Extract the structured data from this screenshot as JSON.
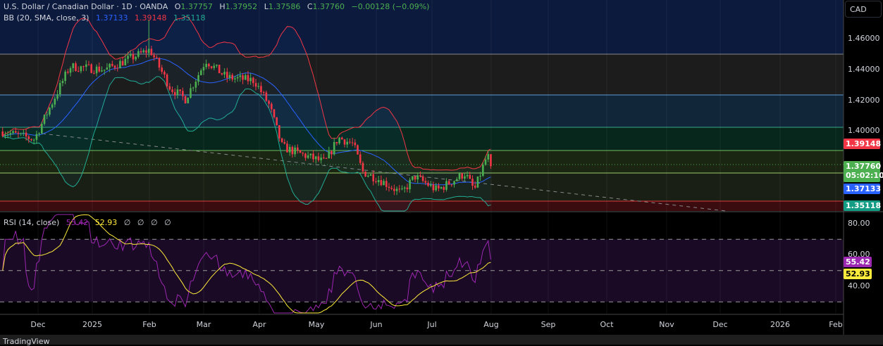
{
  "header": {
    "symbol": "U.S. Dollar / Canadian Dollar · 1D · OANDA",
    "o_label": "O",
    "o": "1.37757",
    "h_label": "H",
    "h": "1.37952",
    "l_label": "L",
    "l": "1.37586",
    "c_label": "C",
    "c": "1.37760",
    "change": "−0.00128 (−0.09%)"
  },
  "bb": {
    "label": "BB (20, SMA, close, 3)",
    "basis": "1.37133",
    "upper": "1.39148",
    "lower": "1.35118"
  },
  "rsi": {
    "label": "RSI (14, close)",
    "value": "55.42",
    "ma": "52.93",
    "extras": [
      "∅",
      "∅",
      "∅",
      "∅"
    ]
  },
  "currency_button": "CAD",
  "price_axis": [
    "1.46000",
    "1.44000",
    "1.42000",
    "1.40000"
  ],
  "price_tags": {
    "upper": "1.39148",
    "last": "1.37760",
    "countdown": "05:02:10",
    "basis": "1.37133",
    "lower": "1.35118"
  },
  "rsi_axis": [
    "80.00",
    "60.00",
    "40.00"
  ],
  "rsi_tags": {
    "rsi": "55.42",
    "ma": "52.93"
  },
  "time_axis": [
    "Dec",
    "2025",
    "Feb",
    "Mar",
    "Apr",
    "May",
    "Jun",
    "Jul",
    "Aug",
    "Sep",
    "Oct",
    "Nov",
    "Dec",
    "2026",
    "Feb"
  ],
  "footer": "TradingView",
  "colors": {
    "up": "#4caf50",
    "down": "#f23645",
    "upper": "#f23645",
    "basis": "#2962ff",
    "lower": "#22ab94",
    "rsi": "#9c27b0",
    "rsi_ma": "#ffeb3b"
  },
  "chart_data": {
    "type": "candlestick",
    "title": "USD/CAD 1D",
    "ylim": [
      1.345,
      1.485
    ],
    "key_closes": [
      [
        "2024-11-12",
        1.4
      ],
      [
        "2024-11-29",
        1.395
      ],
      [
        "2024-12-18",
        1.442
      ],
      [
        "2025-01-06",
        1.44
      ],
      [
        "2025-01-30",
        1.453
      ],
      [
        "2025-02-10",
        1.428
      ],
      [
        "2025-02-18",
        1.421
      ],
      [
        "2025-03-01",
        1.446
      ],
      [
        "2025-03-12",
        1.435
      ],
      [
        "2025-03-27",
        1.433
      ],
      [
        "2025-04-04",
        1.417
      ],
      [
        "2025-04-11",
        1.39
      ],
      [
        "2025-04-22",
        1.385
      ],
      [
        "2025-05-04",
        1.38
      ],
      [
        "2025-05-11",
        1.396
      ],
      [
        "2025-05-19",
        1.392
      ],
      [
        "2025-05-24",
        1.374
      ],
      [
        "2025-06-02",
        1.369
      ],
      [
        "2025-06-14",
        1.36
      ],
      [
        "2025-06-21",
        1.371
      ],
      [
        "2025-07-03",
        1.362
      ],
      [
        "2025-07-18",
        1.373
      ],
      [
        "2025-07-23",
        1.362
      ],
      [
        "2025-07-30",
        1.385
      ],
      [
        "2025-08-01",
        1.3776
      ]
    ],
    "rsi_levels": [
      70,
      50,
      30
    ]
  }
}
